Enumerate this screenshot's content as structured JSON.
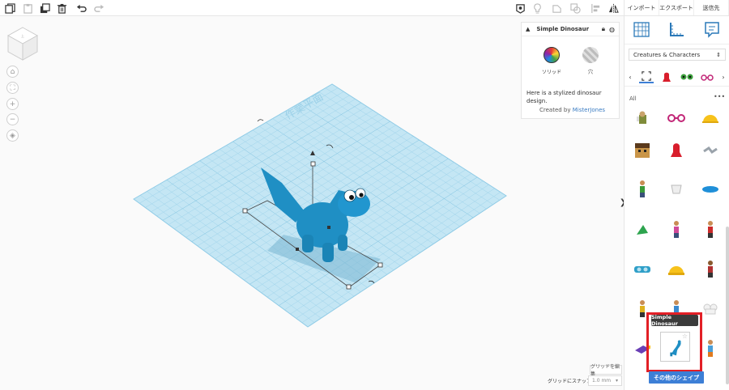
{
  "toolbar": {
    "icons": [
      "copy-icon",
      "paste-icon",
      "duplicate-icon",
      "delete-icon",
      "undo-icon",
      "redo-icon"
    ],
    "view_icons": [
      "visibility-icon",
      "light-icon",
      "shape-icon",
      "group-icon",
      "align-icon",
      "mirror-icon"
    ]
  },
  "top_menu": {
    "import_label": "インポート",
    "export_label": "エクスポート",
    "send_label": "送信先"
  },
  "nav_buttons": [
    "home-icon",
    "fit-icon",
    "zoom-in-icon",
    "zoom-out-icon",
    "perspective-icon"
  ],
  "workplane": {
    "grid_color": "#bfe3f2",
    "line_color": "#8fcbe6",
    "shape_color": "#1f8fc4",
    "edit_grid_label": "グリッドを編集",
    "snap_label": "グリッドにスナップ",
    "snap_value": "1.0 mm"
  },
  "inspector": {
    "title": "Simple Dinosaur",
    "solid_label": "ソリッド",
    "hole_label": "穴",
    "description": "Here is a stylized dinosaur design.",
    "created_by": "Created by",
    "creator": "MisterJones"
  },
  "shapes_panel": {
    "category": "Creatures & Characters",
    "all_label": "All",
    "more_dots": "•••",
    "tooltip": "Simple Dinosaur",
    "more_shapes_button": "その他のシェイプ"
  },
  "colors": {
    "accent": "#3d7fd6",
    "highlight": "#e21f26",
    "link": "#3a7cc2"
  }
}
